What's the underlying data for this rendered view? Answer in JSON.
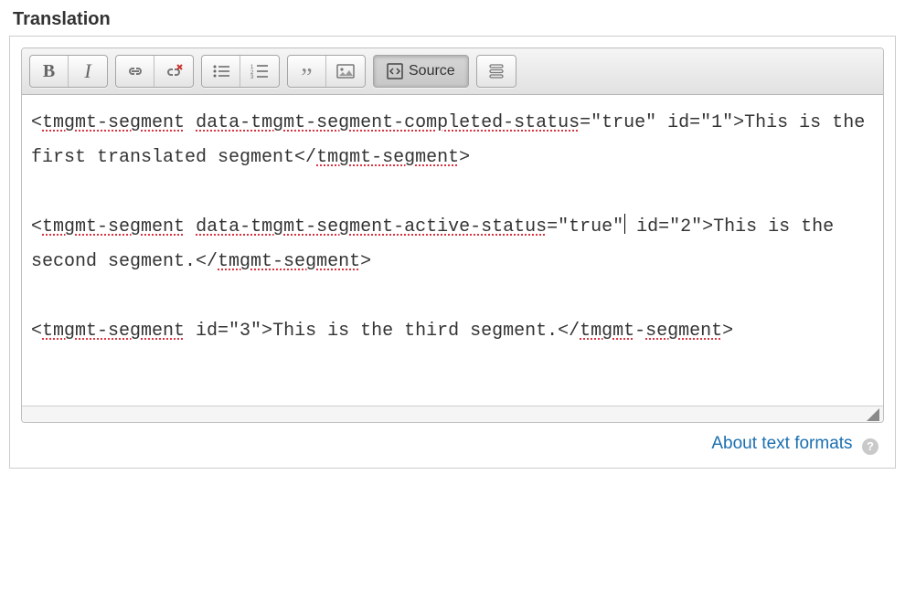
{
  "label": "Translation",
  "toolbar": {
    "source_label": "Source"
  },
  "editor": {
    "segments": [
      {
        "id": "1",
        "attrs": "data-tmgmt-segment-completed-status=\"true\"",
        "text": "This is the first translated segment"
      },
      {
        "id": "2",
        "attrs": "data-tmgmt-segment-active-status=\"true\"",
        "text": "This is the second segment."
      },
      {
        "id": "3",
        "attrs": "",
        "text": "This is the third segment."
      }
    ]
  },
  "footer": {
    "link_label": "About text formats",
    "help_symbol": "?"
  }
}
